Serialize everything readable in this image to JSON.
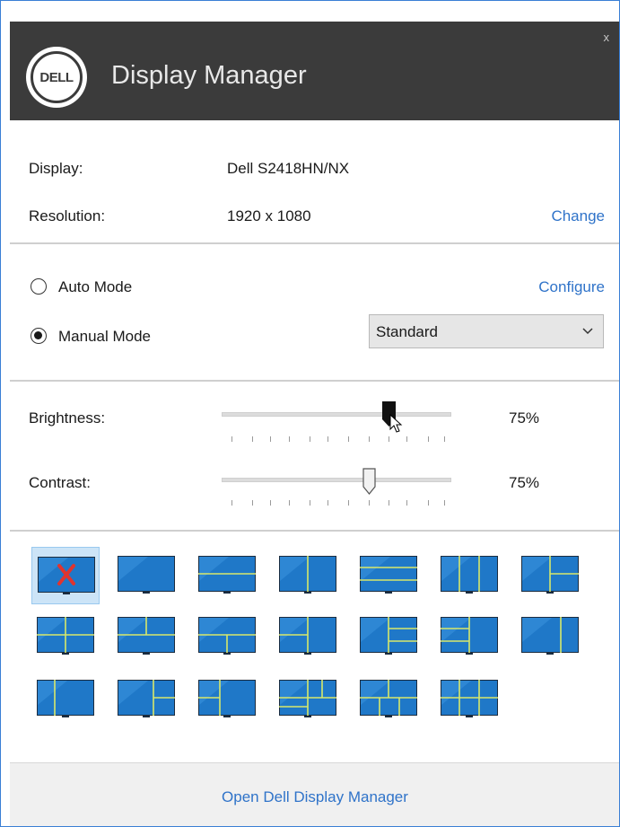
{
  "window": {
    "title": "Display Manager",
    "close_label": "x",
    "logo_text": "DELL"
  },
  "info": {
    "display_label": "Display:",
    "display_value": "Dell S2418HN/NX",
    "resolution_label": "Resolution:",
    "resolution_value": "1920 x 1080",
    "change_link": "Change"
  },
  "mode": {
    "auto_label": "Auto Mode",
    "auto_selected": false,
    "configure_link": "Configure",
    "manual_label": "Manual Mode",
    "manual_selected": true,
    "preset_value": "Standard"
  },
  "sliders": {
    "brightness_label": "Brightness:",
    "brightness_value": "75%",
    "brightness_level": 0.75,
    "contrast_label": "Contrast:",
    "contrast_value": "75%",
    "contrast_level": 0.75
  },
  "layouts": {
    "selected": "none",
    "items": [
      "none",
      "full",
      "2-horizontal",
      "2-vertical",
      "3-horizontal",
      "3-vertical",
      "4-grid",
      "l-left-3",
      "t-top-2",
      "t-bottom-2",
      "left-bottom-2",
      "left-3-right",
      "right-3-left",
      "right-narrow",
      "left-narrow",
      "right-2-stack",
      "left-2-stack",
      "mixed-5",
      "mixed-5b",
      "grid-6"
    ]
  },
  "footer": {
    "open_link": "Open Dell Display Manager"
  },
  "colors": {
    "accent": "#2f73c9",
    "titlebar": "#3b3b3b",
    "tile_blue": "#1f78c8",
    "tile_divider": "#d8e86a",
    "none_mark": "#e0342f"
  }
}
